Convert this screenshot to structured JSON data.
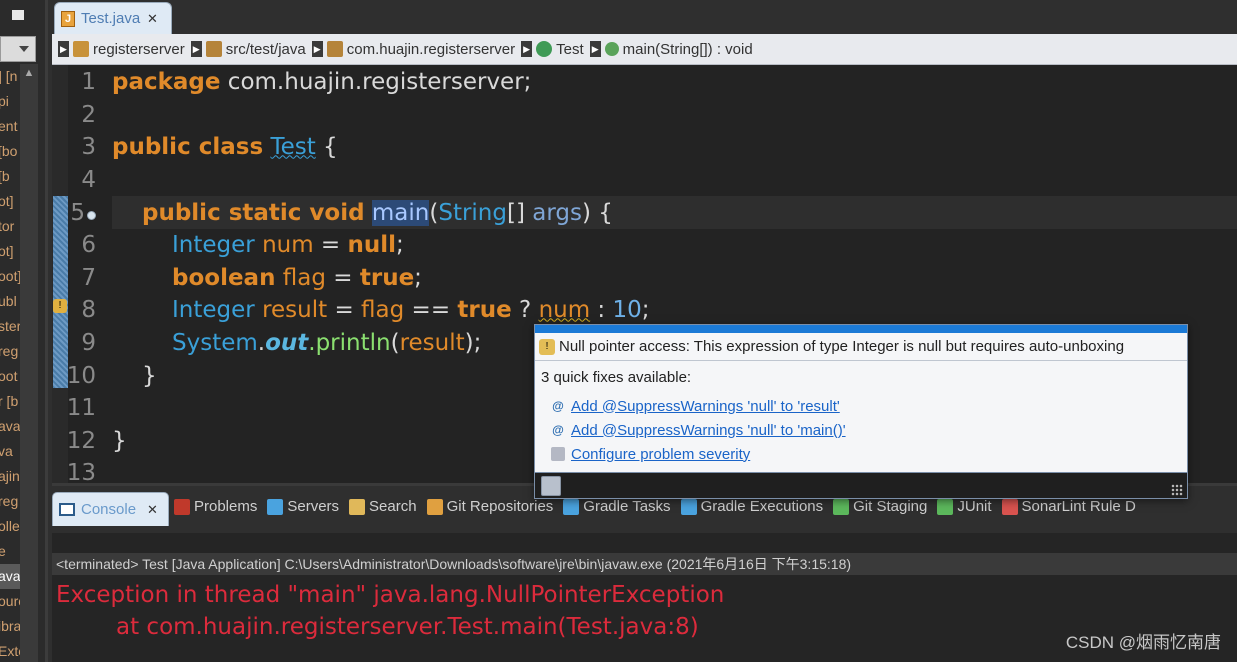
{
  "left_panel": {
    "items": [
      "] [n",
      "pi",
      "ent",
      "[bo",
      "[b",
      "ot]",
      "tor",
      "ot]",
      "oot]",
      "ubl",
      "ster",
      "reg",
      "oot",
      "r [b",
      "ava",
      "va",
      "ajin",
      "reg",
      "olle",
      "e",
      "ava",
      "ourc",
      "ibra",
      "Exte"
    ],
    "selected_index": 20
  },
  "editor_tab": {
    "label": "Test.java",
    "close": "✕"
  },
  "breadcrumb": [
    {
      "label": "registerserver",
      "icon": "project-icon"
    },
    {
      "label": "src/test/java",
      "icon": "source-folder-icon"
    },
    {
      "label": "com.huajin.registerserver",
      "icon": "package-icon"
    },
    {
      "label": "Test",
      "icon": "class-icon"
    },
    {
      "label": "main(String[]) : void",
      "icon": "method-icon"
    }
  ],
  "code": {
    "line_numbers": [
      "1",
      "2",
      "3",
      "4",
      "5",
      "6",
      "7",
      "8",
      "9",
      "10",
      "11",
      "12",
      "13"
    ],
    "l1": {
      "kw": "package",
      "rest": " com.huajin.registerserver;"
    },
    "l3": {
      "kw": "public class",
      "cls": "Test",
      "rest": " {"
    },
    "l5": {
      "kw": "public static void",
      "method": "main",
      "paren": "(",
      "type": "String",
      "arr": "[] ",
      "param": "args",
      "rest": ") {"
    },
    "l6": {
      "type": "Integer",
      "var": "num",
      "eq": " = ",
      "kw": "null",
      "semi": ";"
    },
    "l7": {
      "kw": "boolean",
      "var": "flag",
      "eq": " = ",
      "val": "true",
      "semi": ";"
    },
    "l8": {
      "type": "Integer",
      "var": "result",
      "eq": " = ",
      "var2": "flag",
      "op": " == ",
      "val": "true",
      "q": " ? ",
      "var3": "num",
      "colon": " : ",
      "num": "10",
      "semi": ";"
    },
    "l9": {
      "cls": "System",
      "dot": ".",
      "field": "out",
      "call": ".println",
      "open": "(",
      "arg": "result",
      "close": ");"
    },
    "l10": {
      "text": "}"
    },
    "l12": {
      "text": "}"
    }
  },
  "quickfix": {
    "message": "Null pointer access: This expression of type Integer is null but requires auto-unboxing",
    "count": "3 quick fixes available:",
    "fixes": [
      "Add @SuppressWarnings 'null' to 'result'",
      "Add @SuppressWarnings 'null' to 'main()'",
      "Configure problem severity"
    ]
  },
  "bottom_tabs": {
    "console": {
      "label": "Console",
      "close": "✕"
    },
    "views": [
      "Problems",
      "Servers",
      "Search",
      "Git Repositories",
      "Gradle Tasks",
      "Gradle Executions",
      "Git Staging",
      "JUnit",
      "SonarLint Rule D"
    ]
  },
  "console": {
    "header": "<terminated> Test [Java Application] C:\\Users\\Administrator\\Downloads\\software\\jre\\bin\\javaw.exe (2021年6月16日 下午3:15:18)",
    "line1": "Exception in thread \"main\" java.lang.NullPointerException",
    "line2": "at com.huajin.registerserver.Test.main(Test.java:8)"
  },
  "watermark": "CSDN @烟雨忆南唐"
}
